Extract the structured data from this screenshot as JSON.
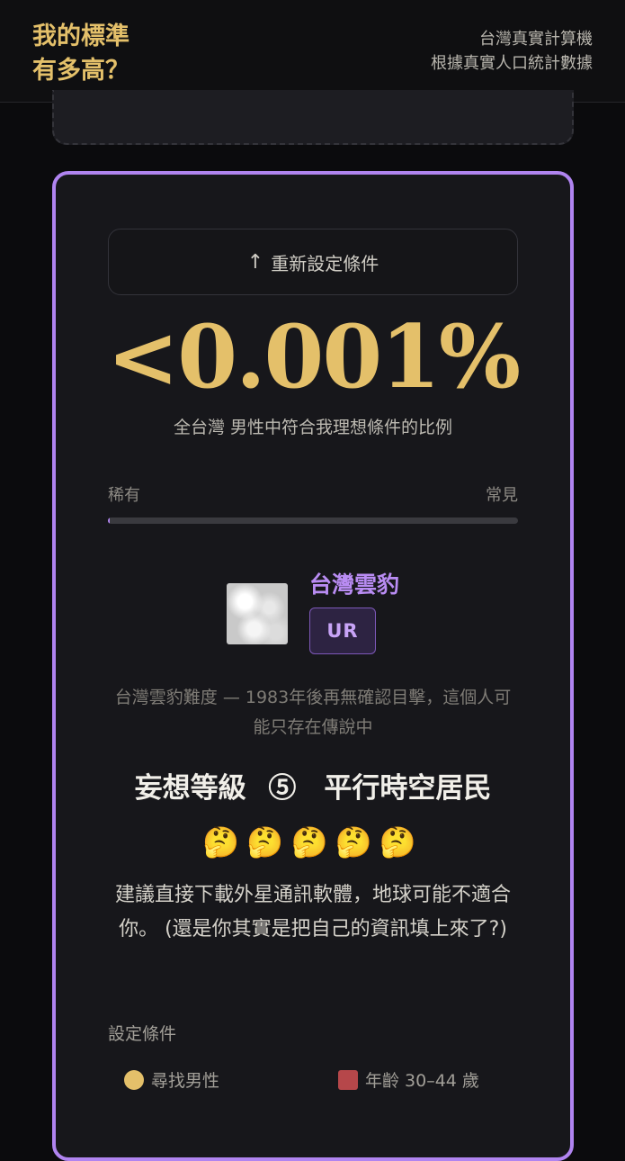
{
  "header": {
    "brand_line1": "我的標準",
    "brand_line2": "有多高？",
    "tagline_line1": "台灣真實計算機",
    "tagline_line2": "根據真實人口統計數據"
  },
  "result": {
    "reset_label": "重新設定條件",
    "reset_icon": "arrow-up-icon",
    "percent": "<0.001%",
    "caption": "全台灣 男性中符合我理想條件的比例",
    "scale": {
      "rare": "稀有",
      "common": "常見"
    },
    "animal": {
      "name": "台灣雲豹",
      "rarity": "UR",
      "description": "台灣雲豹難度 — 1983年後再無確認目擊，這個人可能只存在傳說中"
    },
    "level_title": "妄想等級 ⑤　平行時空居民",
    "emojis": "🤔🤔🤔🤔🤔",
    "advice": "建議直接下載外星通訊軟體，地球可能不適合你。 (還是你其實是把自己的資訊填上來了?)",
    "conditions_label": "設定條件",
    "conditions": [
      {
        "icon": "person-icon",
        "text": "尋找男性"
      },
      {
        "icon": "calendar-icon",
        "text": "年齡 30–44 歲"
      }
    ]
  },
  "colors": {
    "accent_gold": "#e4c06a",
    "accent_purple": "#b084f0",
    "background": "#0b0b0d"
  }
}
